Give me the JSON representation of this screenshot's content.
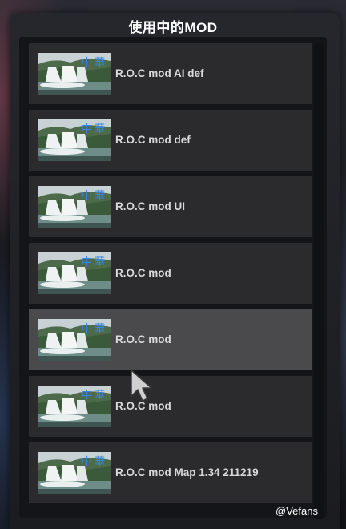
{
  "window": {
    "title": "使用中的MOD"
  },
  "mods": [
    {
      "name": "R.O.C mod AI def",
      "thumb_text": "中華"
    },
    {
      "name": "R.O.C mod def",
      "thumb_text": "中華"
    },
    {
      "name": "R.O.C mod UI",
      "thumb_text": "中華"
    },
    {
      "name": "R.O.C mod",
      "thumb_text": "中華"
    },
    {
      "name": "R.O.C mod",
      "thumb_text": "中華",
      "state": "hover"
    },
    {
      "name": "R.O.C mod",
      "thumb_text": "中華"
    },
    {
      "name": "R.O.C mod Map 1.34 211219",
      "thumb_text": "中華"
    }
  ],
  "watermark": "@Vefans",
  "icons": {
    "cursor": "mouse-pointer-icon",
    "thumbnail": "waterfall-thumbnail-icon"
  },
  "colors": {
    "item_bg": "#2b2b2d",
    "item_hover_bg": "#4a4a4c",
    "title": "#ffffff",
    "thumb_text": "#3a86e0"
  }
}
